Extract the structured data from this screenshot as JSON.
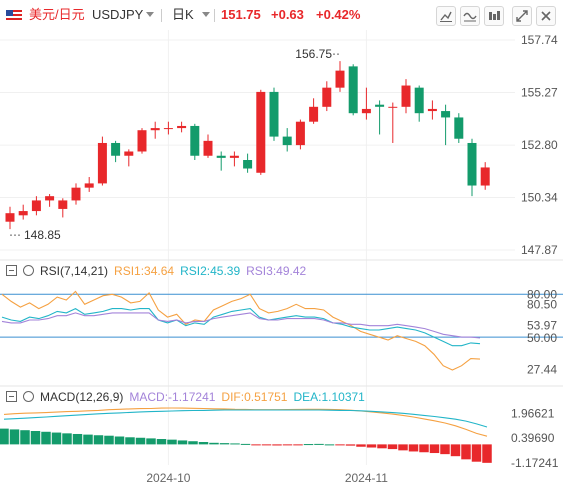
{
  "header": {
    "flag_icon": "us-flag-icon",
    "name": "美元/日元",
    "symbol": "USDJPY",
    "interval": "日K",
    "price": "151.75",
    "change": "+0.63",
    "change_pct": "+0.42%",
    "tools": [
      "chart-settings-icon",
      "indicator-icon",
      "layout-icon",
      "fullscreen-icon",
      "close-icon"
    ],
    "colors": {
      "up": "#e8282b",
      "down": "#139b6b",
      "price": "#e8282b"
    }
  },
  "chart_data": [
    {
      "type": "candlestick",
      "series_name": "USDJPY",
      "ohlc": [
        [
          149.2,
          149.9,
          148.85,
          149.6
        ],
        [
          149.5,
          150.0,
          149.3,
          149.7
        ],
        [
          149.7,
          150.4,
          149.5,
          150.2
        ],
        [
          150.2,
          150.5,
          149.9,
          150.4
        ],
        [
          149.8,
          150.3,
          149.4,
          150.2
        ],
        [
          150.2,
          151.0,
          150.0,
          150.8
        ],
        [
          150.8,
          151.3,
          150.6,
          151.0
        ],
        [
          151.0,
          153.2,
          150.9,
          152.9
        ],
        [
          152.9,
          153.0,
          152.0,
          152.3
        ],
        [
          152.3,
          152.6,
          151.8,
          152.5
        ],
        [
          152.5,
          153.6,
          152.4,
          153.5
        ],
        [
          153.5,
          153.9,
          153.1,
          153.6
        ],
        [
          153.6,
          153.9,
          153.3,
          153.6
        ],
        [
          153.6,
          153.9,
          153.4,
          153.7
        ],
        [
          153.7,
          153.8,
          152.1,
          152.3
        ],
        [
          152.3,
          153.3,
          152.2,
          153.0
        ],
        [
          152.3,
          152.5,
          151.6,
          152.2
        ],
        [
          152.2,
          152.5,
          151.8,
          152.3
        ],
        [
          152.1,
          152.4,
          151.5,
          151.7
        ],
        [
          151.5,
          155.4,
          151.4,
          155.3
        ],
        [
          155.3,
          155.5,
          153.0,
          153.2
        ],
        [
          153.2,
          153.6,
          152.5,
          152.8
        ],
        [
          152.8,
          154.0,
          152.6,
          153.9
        ],
        [
          153.9,
          155.0,
          153.8,
          154.6
        ],
        [
          154.6,
          155.8,
          154.4,
          155.5
        ],
        [
          155.5,
          156.75,
          155.3,
          156.3
        ],
        [
          156.5,
          156.6,
          154.2,
          154.3
        ],
        [
          154.3,
          155.5,
          154.0,
          154.5
        ],
        [
          154.7,
          154.9,
          153.3,
          154.6
        ],
        [
          154.6,
          154.8,
          152.9,
          154.6
        ],
        [
          154.6,
          155.9,
          154.3,
          155.6
        ],
        [
          155.5,
          155.6,
          153.9,
          154.3
        ],
        [
          154.4,
          154.9,
          154.0,
          154.5
        ],
        [
          154.4,
          154.7,
          152.8,
          154.1
        ],
        [
          154.1,
          154.3,
          152.9,
          153.1
        ],
        [
          152.9,
          153.1,
          150.4,
          150.9
        ],
        [
          150.9,
          152.0,
          150.7,
          151.75
        ]
      ],
      "y_ticks": [
        "157.74",
        "155.27",
        "152.80",
        "150.34",
        "147.87"
      ],
      "ylim": [
        147.87,
        157.74
      ],
      "annotations": [
        "156.75",
        "148.85"
      ],
      "x_ticks": [
        "2024-10",
        "2024-11"
      ]
    },
    {
      "type": "line",
      "indicator": "RSI(7,14,21)",
      "values_text": [
        "RSI1:34.64",
        "RSI2:45.39",
        "RSI3:49.42"
      ],
      "y_ticks": [
        "80.00",
        "80.50",
        "53.97",
        "50.00",
        "27.44"
      ],
      "ylim": [
        20,
        90
      ],
      "ref_lines": [
        80,
        50
      ],
      "series": [
        {
          "name": "RSI1",
          "color": "#f5a142",
          "values": [
            80,
            75,
            71,
            74,
            70,
            73,
            78,
            76,
            82,
            73,
            76,
            79,
            80,
            78,
            74,
            75,
            81,
            69,
            64,
            66,
            59,
            62,
            61,
            69,
            72,
            75,
            77,
            80,
            70,
            67,
            68,
            70,
            73,
            70,
            70,
            69,
            64,
            61,
            58,
            54,
            52,
            50,
            48,
            51,
            49,
            47,
            44,
            38,
            30,
            27,
            30,
            35,
            34.64
          ]
        },
        {
          "name": "RSI2",
          "color": "#22b5c8",
          "values": [
            64,
            62,
            61,
            64,
            63,
            65,
            68,
            67,
            70,
            66,
            67,
            68,
            70,
            70,
            69,
            70,
            70,
            62,
            60,
            62,
            58,
            60,
            59,
            64,
            66,
            68,
            69,
            70,
            64,
            62,
            63,
            64,
            65,
            64,
            64,
            63,
            60,
            59,
            57,
            56,
            55,
            55,
            56,
            57,
            56,
            55,
            53,
            50,
            47,
            44,
            44,
            46,
            45.39
          ]
        },
        {
          "name": "RSI3",
          "color": "#a383d9",
          "values": [
            61,
            60,
            60,
            62,
            62,
            63,
            65,
            65,
            67,
            65,
            65,
            66,
            67,
            67,
            67,
            67,
            67,
            62,
            61,
            62,
            60,
            61,
            61,
            63,
            64,
            65,
            66,
            67,
            63,
            62,
            62,
            63,
            63,
            63,
            63,
            62,
            60,
            60,
            59,
            59,
            58,
            58,
            58,
            59,
            58,
            57,
            56,
            54,
            52,
            51,
            50,
            50,
            49.42
          ]
        }
      ]
    },
    {
      "type": "bar+line",
      "indicator": "MACD(12,26,9)",
      "values_text": [
        "MACD:-1.17241",
        "DIF:0.51751",
        "DEA:1.10371"
      ],
      "y_ticks": [
        "1.96621",
        "0.39690",
        "-1.17241"
      ],
      "ylim": [
        -1.5,
        2.5
      ],
      "macd_hist": [
        1.0,
        0.95,
        0.9,
        0.85,
        0.8,
        0.75,
        0.7,
        0.66,
        0.62,
        0.58,
        0.55,
        0.5,
        0.45,
        0.42,
        0.38,
        0.34,
        0.3,
        0.25,
        0.2,
        0.15,
        0.1,
        0.08,
        0.06,
        0.03,
        -0.05,
        -0.06,
        -0.07,
        -0.05,
        -0.03,
        0.02,
        0.03,
        0.0,
        -0.02,
        -0.08,
        -0.15,
        -0.2,
        -0.25,
        -0.3,
        -0.38,
        -0.45,
        -0.5,
        -0.55,
        -0.62,
        -0.75,
        -0.95,
        -1.1,
        -1.17241
      ],
      "dif": [
        1.9,
        1.95,
        1.98,
        2.0,
        2.02,
        2.05,
        2.08,
        2.1,
        2.13,
        2.16,
        2.2,
        2.23,
        2.25,
        2.27,
        2.28,
        2.3,
        2.31,
        2.3,
        2.29,
        2.28,
        2.26,
        2.25,
        2.23,
        2.22,
        2.2,
        2.2,
        2.2,
        2.21,
        2.22,
        2.23,
        2.23,
        2.22,
        2.2,
        2.17,
        2.12,
        2.06,
        2.0,
        1.92,
        1.84,
        1.74,
        1.62,
        1.5,
        1.36,
        1.18,
        0.95,
        0.7,
        0.51751
      ],
      "dea": [
        1.6,
        1.63,
        1.66,
        1.7,
        1.74,
        1.78,
        1.82,
        1.86,
        1.9,
        1.94,
        1.97,
        2.0,
        2.03,
        2.06,
        2.08,
        2.1,
        2.12,
        2.14,
        2.15,
        2.16,
        2.17,
        2.18,
        2.18,
        2.18,
        2.18,
        2.18,
        2.18,
        2.18,
        2.18,
        2.18,
        2.18,
        2.17,
        2.16,
        2.15,
        2.13,
        2.1,
        2.06,
        2.02,
        1.97,
        1.91,
        1.84,
        1.77,
        1.69,
        1.6,
        1.48,
        1.3,
        1.10371
      ],
      "colors": {
        "dif": "#f5a142",
        "dea": "#22b5c8",
        "up": "#139b6b",
        "down": "#e8282b"
      }
    }
  ]
}
